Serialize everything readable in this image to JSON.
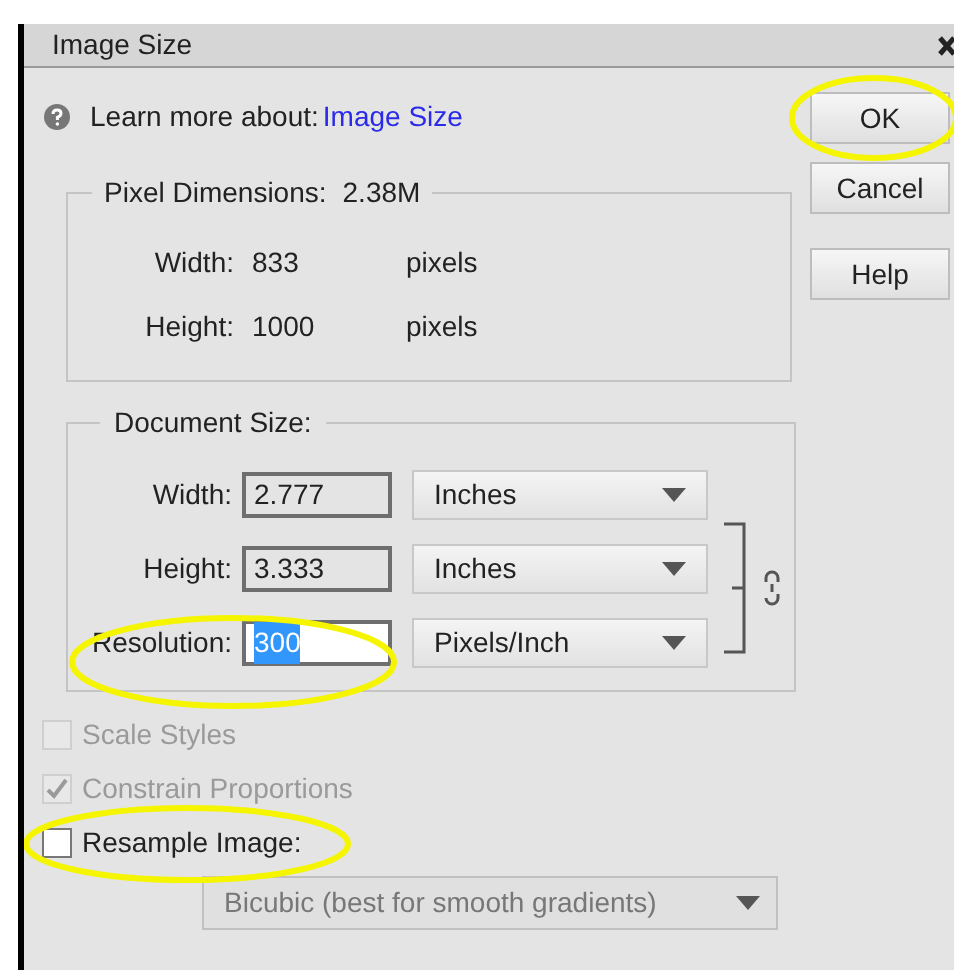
{
  "window": {
    "title": "Image Size"
  },
  "learn_more": {
    "label": "Learn more about:",
    "link": "Image Size"
  },
  "buttons": [
    {
      "label": "OK",
      "highlighted": true
    },
    {
      "label": "Cancel",
      "highlighted": false
    },
    {
      "label": "Help",
      "highlighted": false
    }
  ],
  "pixel_dimensions": {
    "title": "Pixel Dimensions:",
    "value": "2.38M",
    "rows": [
      {
        "label": "Width:",
        "value": "833",
        "unit": "pixels"
      },
      {
        "label": "Height:",
        "value": "1000",
        "unit": "pixels"
      }
    ]
  },
  "document_size": {
    "title": "Document Size:",
    "linked": true,
    "rows": [
      {
        "label": "Width:",
        "value": "2.777",
        "unit": "Inches",
        "value_selected": false,
        "highlighted": false
      },
      {
        "label": "Height:",
        "value": "3.333",
        "unit": "Inches",
        "value_selected": false,
        "highlighted": false
      },
      {
        "label": "Resolution:",
        "value": "300",
        "unit": "Pixels/Inch",
        "value_selected": true,
        "highlighted": true
      }
    ]
  },
  "checkboxes": [
    {
      "label": "Scale Styles",
      "checked": false,
      "disabled": true,
      "highlighted": false
    },
    {
      "label": "Constrain Proportions",
      "checked": true,
      "disabled": true,
      "highlighted": false
    },
    {
      "label": "Resample Image:",
      "checked": false,
      "disabled": false,
      "highlighted": true
    }
  ],
  "resample_method": {
    "value": "Bicubic (best for smooth gradients)",
    "disabled": true
  }
}
